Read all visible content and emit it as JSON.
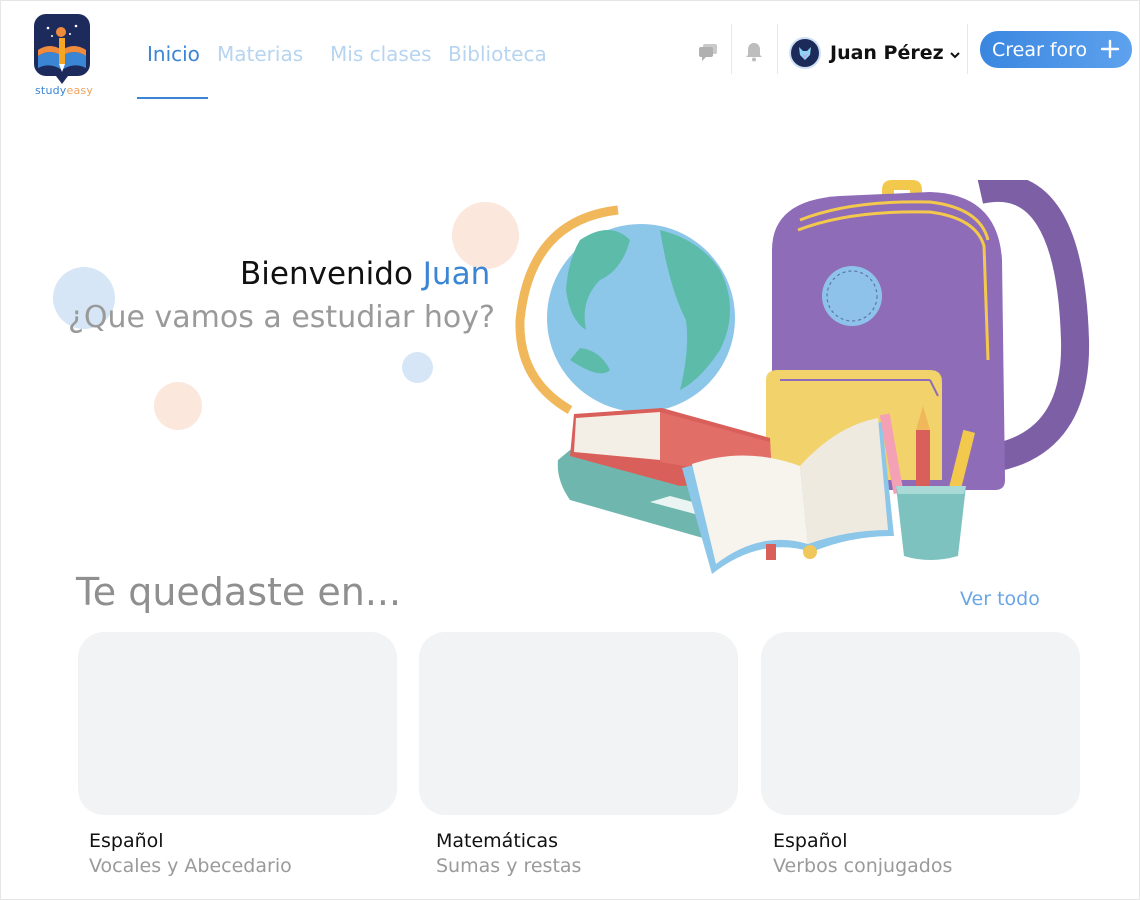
{
  "brand": {
    "logo_text_a": "study",
    "logo_text_b": "easy"
  },
  "nav": {
    "items": [
      {
        "label": "Inicio",
        "active": true
      },
      {
        "label": "Materias",
        "active": false
      },
      {
        "label": "Mis clases",
        "active": false
      },
      {
        "label": "Biblioteca",
        "active": false
      }
    ]
  },
  "header": {
    "chat_icon": "chat-icon",
    "bell_icon": "bell-icon",
    "user_name": "Juan Pérez",
    "create_label": "Crear foro"
  },
  "hero": {
    "greeting": "Bienvenido",
    "greeting_name": "Juan",
    "question": "¿Que vamos a estudiar hoy?"
  },
  "continue": {
    "title": "Te quedaste en...",
    "see_all": "Ver todo",
    "cards": [
      {
        "subject": "Español",
        "topic": "Vocales y Abecedario"
      },
      {
        "subject": "Matemáticas",
        "topic": "Sumas y restas"
      },
      {
        "subject": "Español",
        "topic": "Verbos conjugados"
      }
    ]
  },
  "colors": {
    "accent": "#3a86d4",
    "nav_inactive": "#b7d4f0",
    "muted_text": "#9a9a9a",
    "card_bg": "#f2f3f4"
  }
}
